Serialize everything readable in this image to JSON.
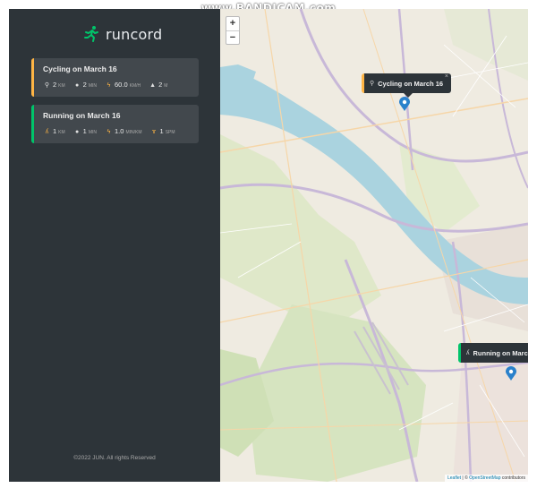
{
  "app": {
    "name": "runcord",
    "watermark": "www.BANDICAM.com"
  },
  "colors": {
    "sidebar_bg": "#2d3439",
    "card_bg": "#42484d",
    "cycling_accent": "#ffb545",
    "running_accent": "#00c46a",
    "logo_green": "#00c46a"
  },
  "workouts": [
    {
      "type": "cycling",
      "title": "Cycling on March 16",
      "details": [
        {
          "icon": "cycling-icon",
          "value": "2",
          "unit": "KM"
        },
        {
          "icon": "stopwatch-icon",
          "value": "2",
          "unit": "MIN"
        },
        {
          "icon": "lightning-icon",
          "value": "60.0",
          "unit": "KM/H"
        },
        {
          "icon": "mountain-icon",
          "value": "2",
          "unit": "M"
        }
      ]
    },
    {
      "type": "running",
      "title": "Running on March 16",
      "details": [
        {
          "icon": "running-icon",
          "value": "1",
          "unit": "KM"
        },
        {
          "icon": "stopwatch-icon",
          "value": "1",
          "unit": "MIN"
        },
        {
          "icon": "lightning-icon",
          "value": "1.0",
          "unit": "MIN/KM"
        },
        {
          "icon": "footprint-icon",
          "value": "1",
          "unit": "SPM"
        }
      ]
    }
  ],
  "footer": {
    "copyright": "©2022 JUN. All rights Reserved"
  },
  "map": {
    "zoom_in": "+",
    "zoom_out": "−",
    "popups": [
      {
        "type": "cycling",
        "text": "Cycling on March 16",
        "close": "×"
      },
      {
        "type": "running",
        "text": "Running on March"
      }
    ],
    "attribution": {
      "leaflet": "Leaflet",
      "separator": " | © ",
      "osm": "OpenStreetMap",
      "suffix": " contributors"
    }
  }
}
